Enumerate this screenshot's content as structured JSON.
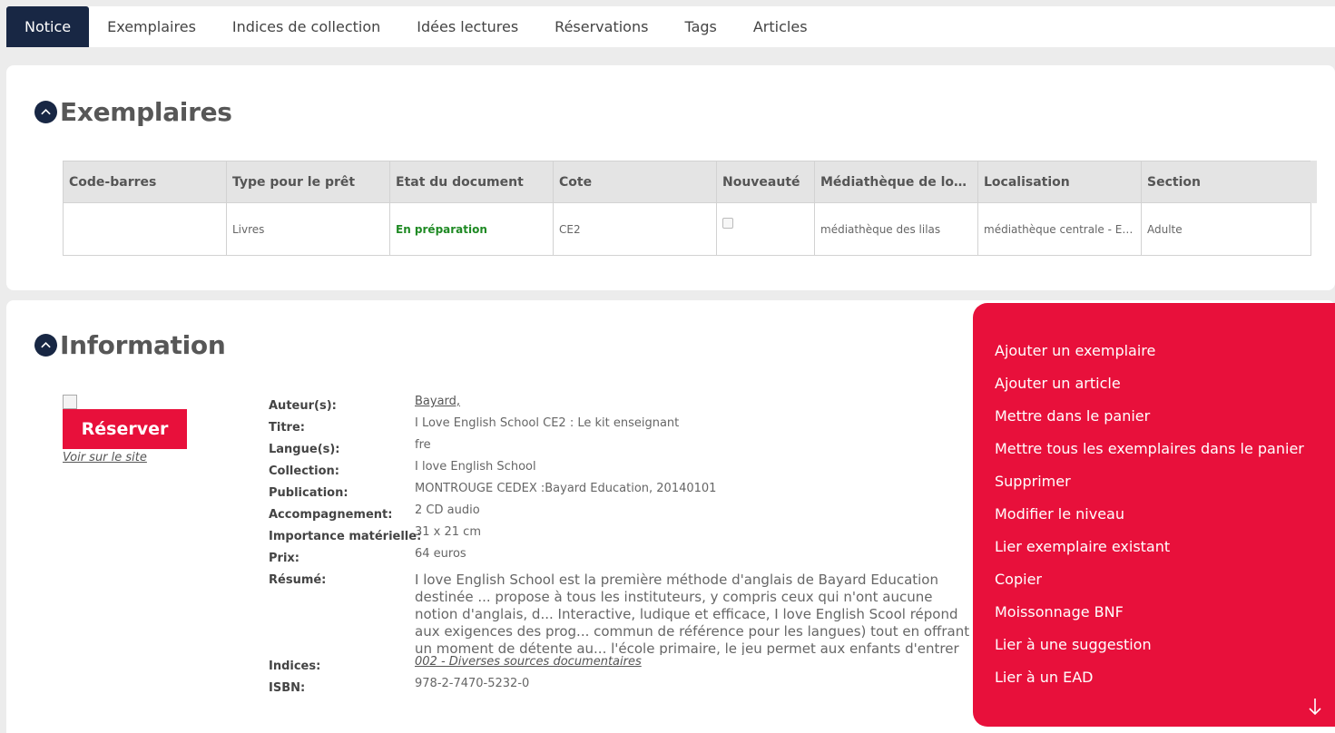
{
  "tabs": [
    {
      "label": "Notice"
    },
    {
      "label": "Exemplaires"
    },
    {
      "label": "Indices de collection"
    },
    {
      "label": "Idées lectures"
    },
    {
      "label": "Réservations"
    },
    {
      "label": "Tags"
    },
    {
      "label": "Articles"
    }
  ],
  "exemplaires": {
    "title": "Exemplaires",
    "columns": [
      "Code-barres",
      "Type pour le prêt",
      "Etat du document",
      "Cote",
      "Nouveauté",
      "Médiathèque de locali...",
      "Localisation",
      "Section"
    ],
    "row": {
      "barcode": "",
      "type": "Livres",
      "status": "En préparation",
      "cote": "CE2",
      "nouveaute": false,
      "mediatheque": "médiathèque des lilas",
      "localisation": "médiathèque centrale - Et...",
      "section": "Adulte"
    }
  },
  "information": {
    "title": "Information",
    "reserve_label": "Réserver",
    "site_link": "Voir sur le site",
    "fields": {
      "auteur_label": "Auteur(s):",
      "auteur": "Bayard,",
      "titre_label": "Titre:",
      "titre": "I Love English School CE2 : Le kit enseignant",
      "langue_label": "Langue(s):",
      "langue": "fre",
      "collection_label": "Collection:",
      "collection": "I love English School",
      "publication_label": "Publication:",
      "publication": "MONTROUGE CEDEX :Bayard Education, 20140101",
      "accompagnement_label": "Accompagnement:",
      "accompagnement": "2 CD audio",
      "importance_label": "Importance matérielle:",
      "importance": "31 x 21 cm",
      "prix_label": "Prix:",
      "prix": "64 euros",
      "resume_label": "Résumé:",
      "resume": "I love English School est la première méthode d'anglais de Bayard Education destinée ... propose à tous les instituteurs, y compris ceux qui n'ont aucune notion d'anglais, d... Interactive, ludique et efficace, I love English Scool répond aux exigences des prog... commun de référence pour les langues) tout en offrant un moment de détente au... l'école primaire, le jeu permet aux enfants d'entrer efficacement en contact avec u...",
      "indices_label": "Indices:",
      "indices": "002 - Diverses sources documentaires",
      "isbn_label": "ISBN:",
      "isbn": "978-2-7470-5232-0"
    }
  },
  "action_menu": {
    "items": [
      "Ajouter un exemplaire",
      "Ajouter un article",
      "Mettre dans le panier",
      "Mettre tous les exemplaires dans le panier",
      "Supprimer",
      "Modifier le niveau",
      "Lier exemplaire existant",
      "Copier",
      "Moissonnage BNF",
      "Lier à une suggestion",
      "Lier à un EAD"
    ],
    "scroll_icon": "arrow-down-icon"
  },
  "colors": {
    "nav_active": "#182744",
    "accent_red": "#e8103b",
    "status_green": "#1f8a24"
  }
}
